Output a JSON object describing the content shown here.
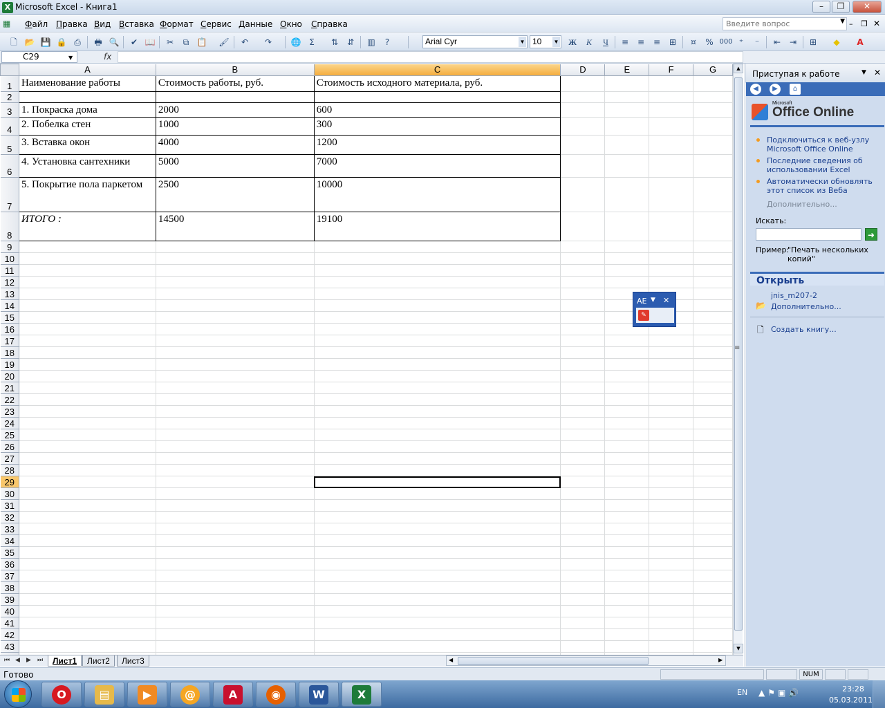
{
  "window": {
    "title": "Microsoft Excel - Книга1",
    "app_icon": "X"
  },
  "menu": [
    "Файл",
    "Правка",
    "Вид",
    "Вставка",
    "Формат",
    "Сервис",
    "Данные",
    "Окно",
    "Справка"
  ],
  "help_placeholder": "Введите вопрос",
  "toolbar": {
    "font_name": "Arial Cyr",
    "font_size": "10",
    "bold": "Ж",
    "italic": "К",
    "underline": "Ч",
    "percent": "%",
    "thousands": "000"
  },
  "formula_bar": {
    "name_box": "C29",
    "fx": "fx",
    "formula": ""
  },
  "sheet": {
    "columns": [
      "A",
      "B",
      "C",
      "D",
      "E",
      "F",
      "G"
    ],
    "selected_column": "C",
    "selected_row": "29",
    "rows": [
      {
        "num": "1",
        "cells": [
          "Наименование работы",
          "Стоимость работы, руб.",
          "Стоимость исходного материала, руб."
        ]
      },
      {
        "num": "2",
        "cells": [
          "",
          "",
          ""
        ]
      },
      {
        "num": "3",
        "cells": [
          "1. Покраска дома",
          "2000",
          "600"
        ]
      },
      {
        "num": "4",
        "cells": [
          "2. Побелка стен",
          "1000",
          "300"
        ]
      },
      {
        "num": "5",
        "cells": [
          "3. Вставка окон",
          "4000",
          "1200"
        ]
      },
      {
        "num": "6",
        "cells": [
          "4. Установка сантехники",
          "5000",
          "7000"
        ]
      },
      {
        "num": "7",
        "cells": [
          "5. Покрытие пола паркетом",
          "2500",
          "10000"
        ]
      },
      {
        "num": "8",
        "cells": [
          "ИТОГО :",
          "14500",
          "19100"
        ]
      }
    ],
    "empty_row_start": 9,
    "empty_row_end": 44
  },
  "tabs": {
    "sheets": [
      "Лист1",
      "Лист2",
      "Лист3"
    ],
    "active": "Лист1"
  },
  "status": {
    "text": "Готово",
    "num": "NUM"
  },
  "task_pane": {
    "title": "Приступая к работе",
    "logo_small": "Microsoft",
    "logo_text": "Office Online",
    "links": [
      "Подключиться к веб-узлу Microsoft Office Online",
      "Последние сведения об использовании Excel",
      "Автоматически обновлять этот список из Веба"
    ],
    "more": "Дополнительно...",
    "search_label": "Искать:",
    "example_label": "Пример:",
    "example_text": "\"Печать нескольких копий\"",
    "open_title": "Открыть",
    "recent_file": "jnis_m207-2",
    "open_more": "Дополнительно...",
    "create_book": "Создать книгу..."
  },
  "lang_widget": {
    "lang": "AE"
  },
  "taskbar": {
    "apps": [
      "opera",
      "explorer",
      "media-player",
      "mail-agent",
      "acrobat",
      "firefox",
      "word",
      "excel"
    ],
    "tray_lang": "EN",
    "time": "23:28",
    "date": "05.03.2011"
  }
}
